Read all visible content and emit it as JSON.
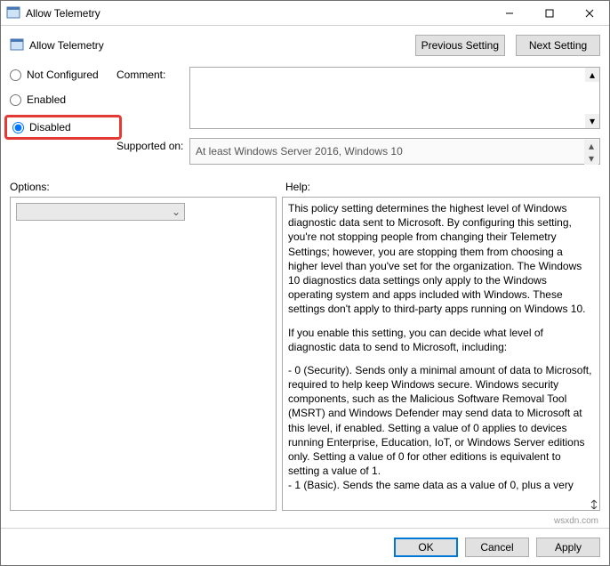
{
  "window": {
    "title": "Allow Telemetry"
  },
  "header": {
    "title": "Allow Telemetry"
  },
  "nav": {
    "prev": "Previous Setting",
    "next": "Next Setting"
  },
  "radios": {
    "not_configured": "Not Configured",
    "enabled": "Enabled",
    "disabled": "Disabled",
    "selected": "disabled"
  },
  "fields": {
    "comment_label": "Comment:",
    "comment_value": "",
    "supported_label": "Supported on:",
    "supported_value": "At least Windows Server 2016, Windows 10"
  },
  "labels": {
    "options": "Options:",
    "help": "Help:"
  },
  "options": {
    "selected_value": ""
  },
  "help": {
    "p1": "This policy setting determines the highest level of Windows diagnostic data sent to Microsoft. By configuring this setting, you're not stopping people from changing their Telemetry Settings; however, you are stopping them from choosing a higher level than you've set for the organization. The Windows 10 diagnostics data settings only apply to the Windows operating system and apps included with Windows. These settings don't apply to third-party apps running on Windows 10.",
    "p2": "If you enable this setting, you can decide what level of diagnostic data to send to Microsoft, including:",
    "p3": "  - 0 (Security). Sends only a minimal amount of data to Microsoft, required to help keep Windows secure. Windows security components, such as the Malicious Software Removal Tool (MSRT) and Windows Defender may send data to Microsoft at this level, if enabled. Setting a value of 0 applies to devices running Enterprise, Education, IoT, or Windows Server editions only. Setting a value of 0 for other editions is equivalent to setting a value of 1.",
    "p4": "  - 1 (Basic). Sends the same data as a value of 0, plus a very"
  },
  "buttons": {
    "ok": "OK",
    "cancel": "Cancel",
    "apply": "Apply"
  },
  "watermark": "wsxdn.com"
}
